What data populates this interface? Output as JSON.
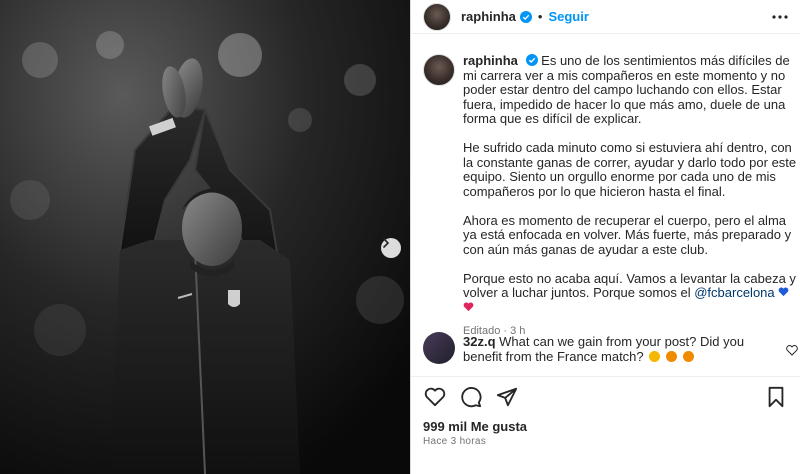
{
  "header": {
    "username": "raphinha",
    "separator": "•",
    "follow_label": "Seguir"
  },
  "caption": {
    "username": "raphinha",
    "paragraph_1": "Es uno de los sentimientos más difíciles de mi carrera ver a mis compañeros en este momento y no poder estar dentro del campo luchando con ellos. Estar fuera, impedido de hacer lo que más amo, duele de una forma que es difícil de explicar.",
    "paragraph_2": "He sufrido cada minuto como si estuviera ahí dentro, con la constante ganas de correr, ayudar y darlo todo por este equipo. Siento un orgullo enorme por cada uno de mis compañeros por lo que hicieron hasta el final.",
    "paragraph_3": "Ahora es momento de recuperar el cuerpo, pero el alma ya está enfocada en volver. Más fuerte, más preparado y con aún más ganas de ayudar a este club.",
    "paragraph_4_text": "Porque esto no acaba aquí. Vamos a levantar la cabeza y volver a luchar juntos. Porque somos el ",
    "mention": "@fcbarcelona",
    "edited_label": "Editado",
    "dot": "·",
    "age": "3 h"
  },
  "comment": {
    "username": "32z.q",
    "text": "What can we gain from your post? Did you benefit from the France match?"
  },
  "footer": {
    "likes": "999 mil Me gusta",
    "timestamp": "Hace 3 horas"
  },
  "colors": {
    "accent": "#0095f6",
    "verified": "#0095f6",
    "mention": "#00376b",
    "heart_blue": "#1e5bd8",
    "heart_red": "#e0245e"
  },
  "icons": [
    "verified-icon",
    "more-options-icon",
    "next-arrow-icon",
    "heart-icon",
    "comment-icon",
    "share-icon",
    "save-icon"
  ]
}
